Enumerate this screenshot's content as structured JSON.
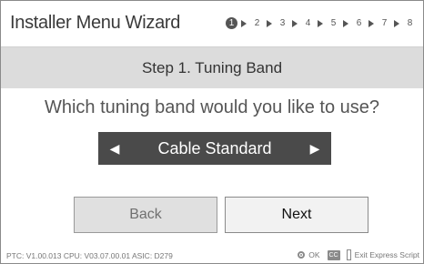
{
  "app": {
    "title": "Installer Menu Wizard"
  },
  "steps": [
    "1",
    "2",
    "3",
    "4",
    "5",
    "6",
    "7",
    "8"
  ],
  "current_step": 1,
  "step_header": "Step 1. Tuning Band",
  "question": "Which tuning band would you like to use?",
  "selector": {
    "value": "Cable Standard",
    "left_icon": "left-arrow-icon",
    "right_icon": "right-arrow-icon"
  },
  "buttons": {
    "back_label": "Back",
    "next_label": "Next"
  },
  "status": {
    "version": "PTC: V1.00.013 CPU: V03.07.00.01 ASIC: D279",
    "ok_label": "OK",
    "cc_label": "CC",
    "exit_label": "Exit Express Script"
  },
  "colors": {
    "selector_bg": "#4a4a4a",
    "header_bg": "#dcdcdc",
    "active_step": "#555555"
  }
}
